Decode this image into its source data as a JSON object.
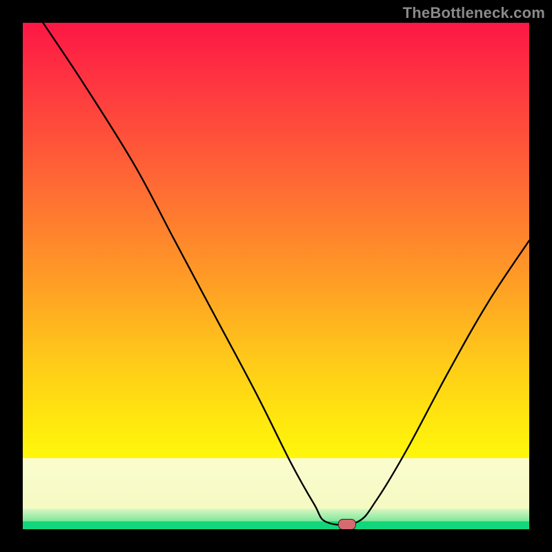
{
  "watermark": "TheBottleneck.com",
  "marker": {
    "x_pct": 64.0,
    "y_pct": 99.0
  },
  "colors": {
    "frame": "#000000",
    "curve": "#000000",
    "marker_fill": "#d66a6f",
    "marker_border": "#3b1f1f",
    "watermark": "#8a8a8a",
    "gradient_top": "#fd1745",
    "gradient_mid": "#ffe60f",
    "gradient_pale": "#fbfccf",
    "gradient_green": "#7fe79a",
    "gradient_base": "#12d67b"
  },
  "chart_data": {
    "type": "line",
    "title": "",
    "xlabel": "",
    "ylabel": "",
    "xlim_pct": [
      0,
      100
    ],
    "ylim_pct": [
      0,
      100
    ],
    "note": "x,y are percentages of the plot area; y=0 is top, y=100 is bottom (as drawn).",
    "series": [
      {
        "name": "bottleneck-curve",
        "points_pct": [
          {
            "x": 4.0,
            "y": 0.0
          },
          {
            "x": 12.0,
            "y": 12.0
          },
          {
            "x": 22.0,
            "y": 28.0
          },
          {
            "x": 30.0,
            "y": 43.0
          },
          {
            "x": 38.0,
            "y": 58.0
          },
          {
            "x": 46.0,
            "y": 73.0
          },
          {
            "x": 53.0,
            "y": 87.0
          },
          {
            "x": 57.5,
            "y": 95.0
          },
          {
            "x": 60.0,
            "y": 98.6
          },
          {
            "x": 66.0,
            "y": 98.6
          },
          {
            "x": 70.0,
            "y": 94.0
          },
          {
            "x": 76.0,
            "y": 84.0
          },
          {
            "x": 84.0,
            "y": 69.0
          },
          {
            "x": 92.0,
            "y": 55.0
          },
          {
            "x": 100.0,
            "y": 43.0
          }
        ]
      }
    ],
    "marker": {
      "x_pct": 64.0,
      "y_pct": 99.0,
      "label": ""
    }
  }
}
